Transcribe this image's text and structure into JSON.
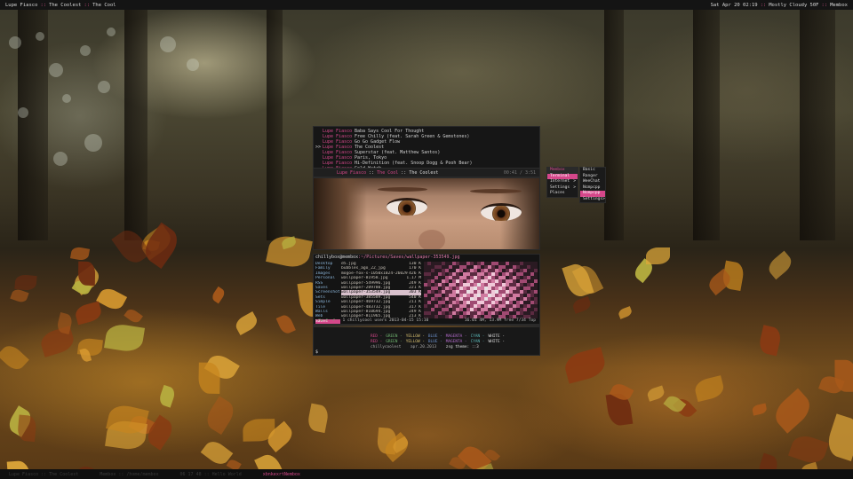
{
  "topbar": {
    "left": [
      "Lupe Fiasco",
      "The Coolest",
      "The Cool"
    ],
    "right": [
      "Sat Apr 20 02:19",
      "Mostly Cloudy 50F",
      "Membox"
    ]
  },
  "bottombar": {
    "segments": [
      "Lupe Fiasco :: The Coolest",
      "Membox :: /home/membox",
      "06 17 48 :: Hello World",
      "obtaining ..."
    ],
    "highlight": "xbnkexrtNembox"
  },
  "music": {
    "tracks": [
      {
        "marker": "",
        "artist": "Lupe Fiasco",
        "title": "Baba Says Cool For Thought"
      },
      {
        "marker": "",
        "artist": "Lupe Fiasco",
        "title": "Free Chilly (feat. Sarah Green & Gemstones)"
      },
      {
        "marker": "",
        "artist": "Lupe Fiasco",
        "title": "Go Go Gadget Flow"
      },
      {
        "marker": ">>",
        "artist": "Lupe Fiasco",
        "title": "The Coolest"
      },
      {
        "marker": "",
        "artist": "Lupe Fiasco",
        "title": "Superstar (feat. Matthew Santos)"
      },
      {
        "marker": "",
        "artist": "Lupe Fiasco",
        "title": "Paris, Tokyo"
      },
      {
        "marker": "",
        "artist": "Lupe Fiasco",
        "title": "Hi-Definition (feat. Snoop Dogg & Pooh Bear)"
      },
      {
        "marker": "",
        "artist": "Lupe Fiasco",
        "title": "Gold Watch"
      }
    ],
    "status_artist": "Lupe Fiasco",
    "status_album": "The Cool",
    "status_track": "The Coolest",
    "status_right": "00:41 / 3:51"
  },
  "fm": {
    "path_user": "chillybox@membox",
    "path": ":~/Pictures/Saves/wallpaper-353549.jpg",
    "col1": [
      {
        "name": "Desktop",
        "sel": false
      },
      {
        "name": "Family",
        "sel": false
      },
      {
        "name": "Images",
        "sel": false
      },
      {
        "name": "Personal",
        "sel": false
      },
      {
        "name": "RSS",
        "sel": false
      },
      {
        "name": "Saves",
        "sel": false
      },
      {
        "name": "Screenshot",
        "sel": false
      },
      {
        "name": "Sets",
        "sel": false
      },
      {
        "name": "Simple",
        "sel": false
      },
      {
        "name": "Tile",
        "sel": false
      },
      {
        "name": "Walls",
        "sel": false
      },
      {
        "name": "Web",
        "sel": false
      },
      {
        "name": "Saves",
        "sel": true
      }
    ],
    "col2": [
      {
        "name": "d5.jpg",
        "size": "130 K",
        "sel": false
      },
      {
        "name": "bubbles_ago_22_jpg",
        "size": "170 K",
        "sel": false
      },
      {
        "name": "mogoe-fox-s-1050x1024-26029",
        "size": "426 K",
        "sel": false
      },
      {
        "name": "wallpaper-81958.jpg",
        "size": "1.17 M",
        "sel": false
      },
      {
        "name": "wallpaper-549996.jpg",
        "size": "249 K",
        "sel": false
      },
      {
        "name": "wallpaper-289780.jpg",
        "size": "221 K",
        "sel": false
      },
      {
        "name": "wallpaper-353549.jpg",
        "size": "303 K",
        "sel": true
      },
      {
        "name": "wallpaper-385589.jpg",
        "size": "540 K",
        "sel": false
      },
      {
        "name": "wallpaper-469732.jpg",
        "size": "211 K",
        "sel": false
      },
      {
        "name": "wallpaper-483732.jpg",
        "size": "317 K",
        "sel": false
      },
      {
        "name": "wallpaper-810694.jpg",
        "size": "249 K",
        "sel": false
      },
      {
        "name": "wallpaper-811965.jpg",
        "size": "213 K",
        "sel": false
      }
    ],
    "foot_perm": "-rw-r--r--",
    "foot_mid": "1 chillycool users 2013-04-15 15:10",
    "foot_right": "16.01 4M, 13.9M free  7/34  Top"
  },
  "term": {
    "line1": [
      "RED",
      "GREEN",
      "YELLOW",
      "BLUE",
      "MAGENTA",
      "CYAN",
      "WHITE"
    ],
    "line2": [
      "RED",
      "GREEN",
      "YELLOW",
      "BLUE",
      "MAGENTA",
      "CYAN",
      "WHITE"
    ],
    "colors": [
      "#d5478a",
      "#6fb36f",
      "#d8c070",
      "#6a8fc8",
      "#b06ac8",
      "#5ab8b8",
      "#dddddd"
    ],
    "info_user": "chillycoolest",
    "info_date": "apr.20.2013",
    "info_theme": "zsg theme: ::3",
    "prompt": "$"
  },
  "menu": {
    "items": [
      {
        "label": "Membox",
        "head": true,
        "act": false
      },
      {
        "label": "Terminal",
        "head": false,
        "act": true
      },
      {
        "label": "Internet",
        "head": false,
        "act": false,
        "arrow": ">"
      },
      {
        "label": "Settings",
        "head": false,
        "act": false,
        "arrow": ">"
      },
      {
        "label": "Places",
        "head": false,
        "act": false
      }
    ],
    "sub": [
      {
        "label": "Basic",
        "act": false
      },
      {
        "label": "Ranger",
        "act": false
      },
      {
        "label": "WeeChat",
        "act": false
      },
      {
        "label": "Ncmpcpp",
        "act": false
      },
      {
        "label": "Ncmpcpp",
        "act": true
      },
      {
        "label": "Settings",
        "act": false,
        "arrow": ">"
      }
    ]
  }
}
